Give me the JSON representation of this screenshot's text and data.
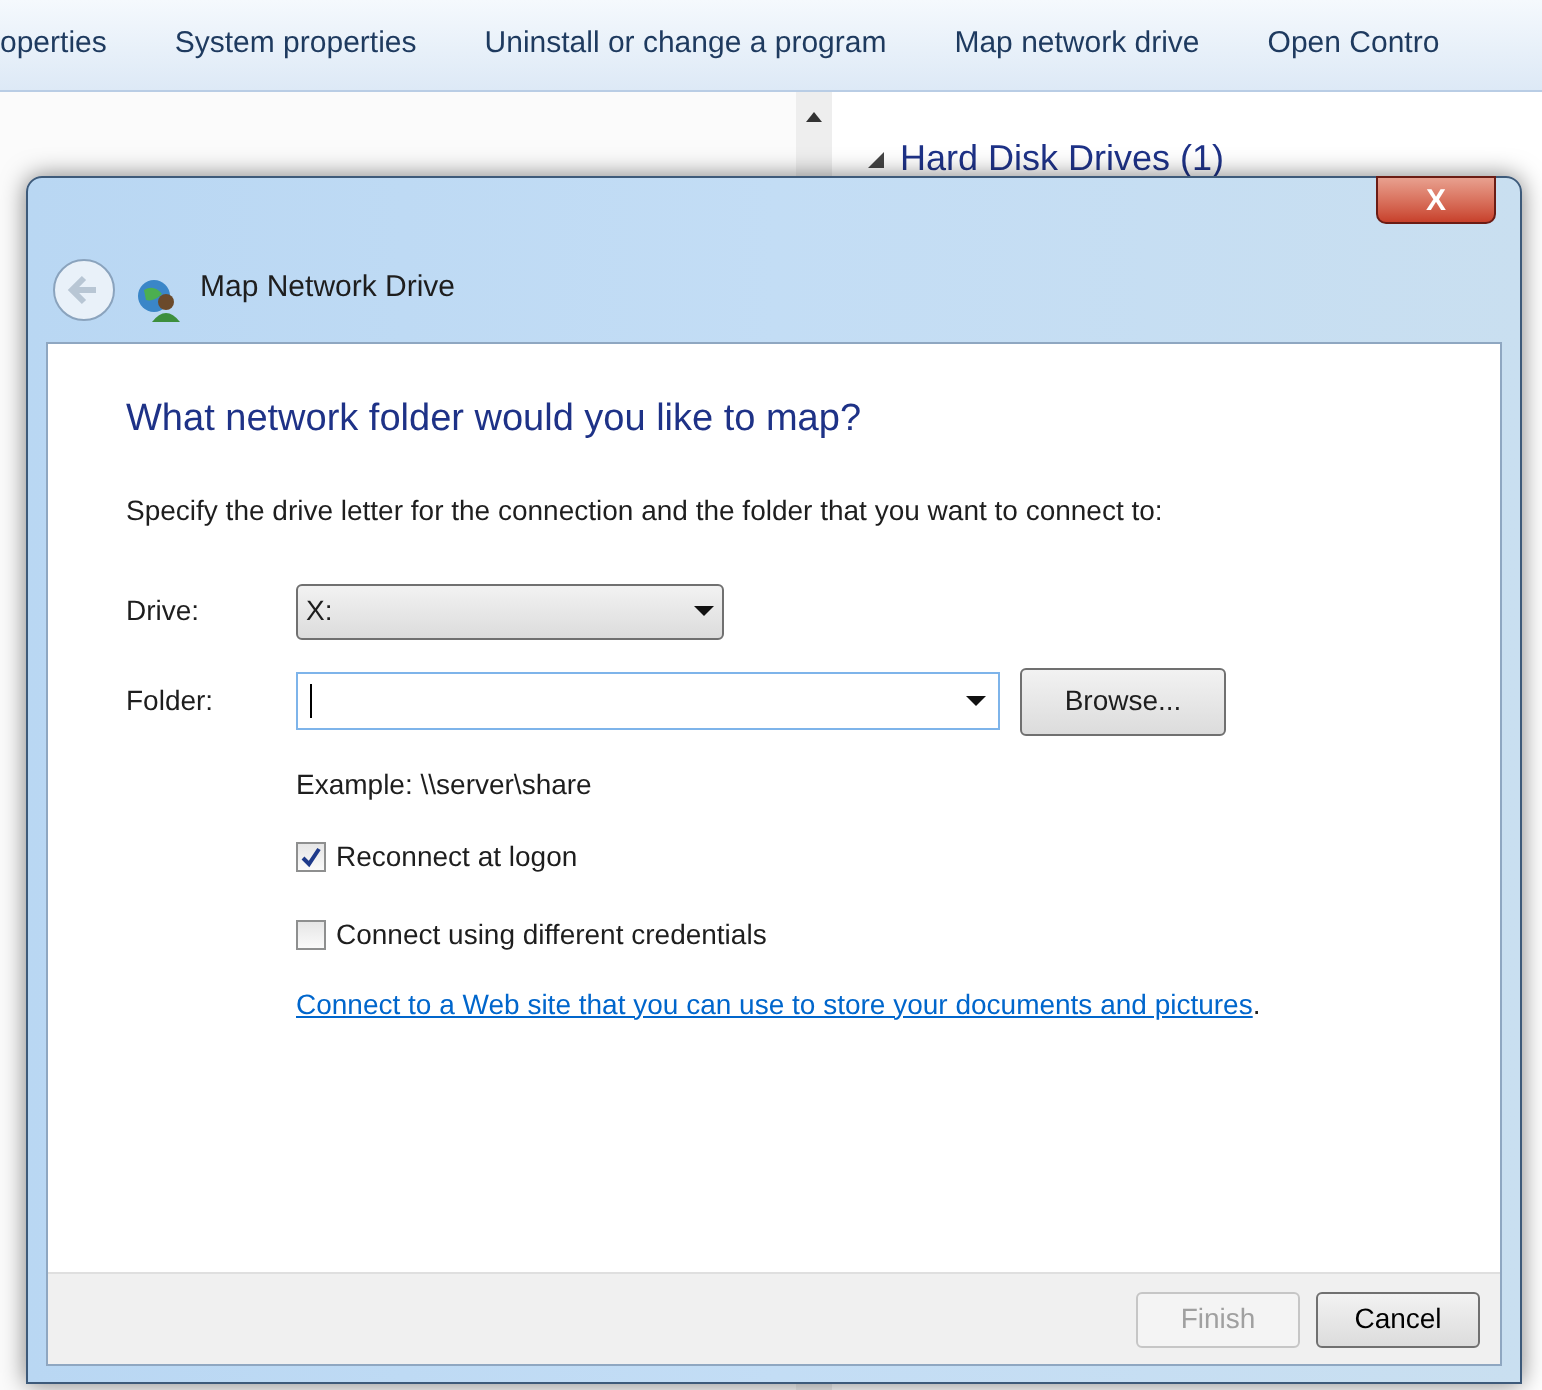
{
  "toolbar": {
    "items": [
      {
        "label": "operties"
      },
      {
        "label": "System properties"
      },
      {
        "label": "Uninstall or change a program"
      },
      {
        "label": "Map network drive"
      },
      {
        "label": "Open Contro"
      }
    ]
  },
  "explorer": {
    "section_header": "Hard Disk Drives (1)",
    "expanded": true
  },
  "dialog": {
    "title": "Map Network Drive",
    "close_label": "X",
    "heading": "What network folder would you like to map?",
    "description": "Specify the drive letter for the connection and the folder that you want to connect to:",
    "drive": {
      "label": "Drive:",
      "value": "X:"
    },
    "folder": {
      "label": "Folder:",
      "button": "Browse..."
    },
    "example": "Example: \\\\server\\share",
    "checkboxes": [
      {
        "label": "Reconnect at logon",
        "checked": true
      },
      {
        "label": "Connect using different credentials",
        "checked": false
      }
    ],
    "link": "Connect to a Web site that you can use to store your documents and pictures",
    "link_suffix": ".",
    "buttons": [
      {
        "label": "Finish",
        "disabled": true
      },
      {
        "label": "Cancel",
        "disabled": false
      }
    ]
  }
}
